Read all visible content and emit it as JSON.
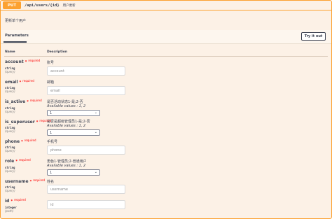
{
  "operation": {
    "method": "PUT",
    "path": "/api/users/{id}",
    "summary": "用户更新",
    "description": "更新单个用户"
  },
  "tabs": {
    "parameters": "Parameters"
  },
  "try_button": "Try it out",
  "columns": {
    "name": "Name",
    "description": "Description"
  },
  "required_label": "required",
  "params": [
    {
      "name": "account",
      "type": "string",
      "in": "(query)",
      "desc": "账号",
      "placeholder": "account"
    },
    {
      "name": "email",
      "type": "string",
      "in": "(query)",
      "desc": "邮箱",
      "placeholder": "email"
    },
    {
      "name": "is_active",
      "type": "string",
      "in": "(query)",
      "desc": "是否活动状态1-是;2-否",
      "available": "Available values : 1, 2",
      "selected": "1"
    },
    {
      "name": "is_superuser",
      "type": "string",
      "in": "(query)",
      "desc": "是否是超级管理员1-是;2-否",
      "available": "Available values : 1, 2",
      "selected": "1"
    },
    {
      "name": "phone",
      "type": "string",
      "in": "(query)",
      "desc": "手机号",
      "placeholder": "phone"
    },
    {
      "name": "role",
      "type": "string",
      "in": "(query)",
      "desc": "角色1-管理员;2-普通用户",
      "available": "Available values : 1, 2",
      "selected": "1"
    },
    {
      "name": "username",
      "type": "string",
      "in": "(query)",
      "desc": "姓名",
      "placeholder": "username"
    },
    {
      "name": "id",
      "type": "integer",
      "in": "(path)",
      "desc": "",
      "placeholder": "id"
    }
  ]
}
